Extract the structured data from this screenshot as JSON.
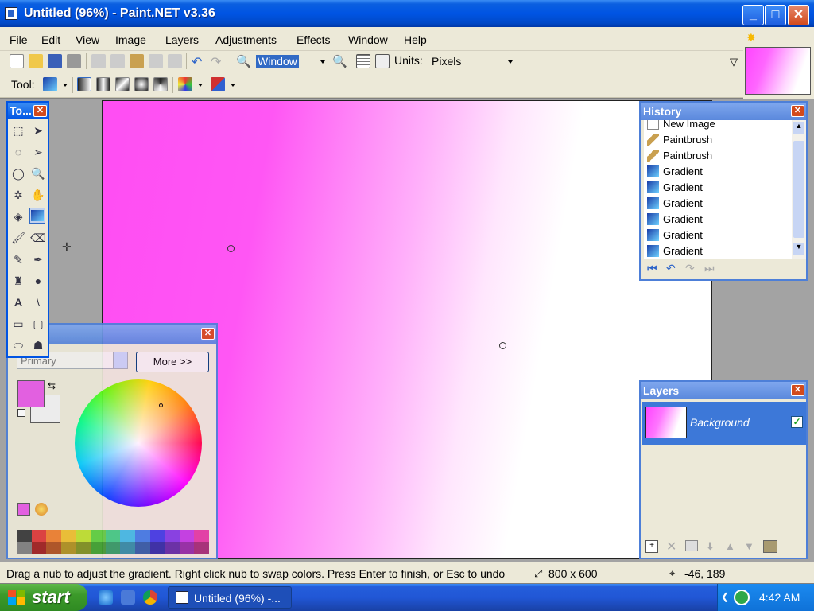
{
  "window": {
    "title": "Untitled (96%) - Paint.NET v3.36",
    "minimize": "_",
    "maximize": "□",
    "close": "✕"
  },
  "menu": [
    "File",
    "Edit",
    "View",
    "Image",
    "Layers",
    "Adjustments",
    "Effects",
    "Window",
    "Help"
  ],
  "toolbar": {
    "zoom_value": "Window",
    "units_label": "Units:",
    "units_value": "Pixels",
    "tool_label": "Tool:"
  },
  "tools_window": {
    "title": "To...",
    "close": "✕",
    "tools": [
      "rectangle-select",
      "move-selection",
      "lasso-select",
      "move-selected",
      "ellipse-select",
      "zoom",
      "magic-wand",
      "pan",
      "paint-bucket",
      "gradient",
      "paintbrush",
      "eraser",
      "pencil",
      "color-picker",
      "clone-stamp",
      "recolor",
      "text",
      "line-curve",
      "rectangle",
      "rounded-rectangle",
      "ellipse",
      "freeform-shape"
    ],
    "active_tool": "gradient"
  },
  "colors_window": {
    "close": "✕",
    "mode": "Primary",
    "more_button": "More >>",
    "primary_color": "#e85be6",
    "secondary_color": "#f3f3f3",
    "palette": [
      "#3a3a3a",
      "#e03a3a",
      "#f08030",
      "#f0c030",
      "#c0e030",
      "#60d040",
      "#40d080",
      "#40c0e0",
      "#4080e0",
      "#4040e0",
      "#8040e0",
      "#c040e0",
      "#e040a0",
      "#808080",
      "#a02020",
      "#b05020",
      "#b09020",
      "#809020",
      "#40a030",
      "#30a060",
      "#3090a0",
      "#3060a0",
      "#3030a0",
      "#6030a0",
      "#9030a0",
      "#a03070"
    ]
  },
  "history": {
    "title": "History",
    "close": "✕",
    "items": [
      "New Image",
      "Paintbrush",
      "Paintbrush",
      "Gradient",
      "Gradient",
      "Gradient",
      "Gradient",
      "Gradient",
      "Gradient"
    ]
  },
  "layers": {
    "title": "Layers",
    "close": "✕",
    "items": [
      {
        "name": "Background",
        "visible": true
      }
    ]
  },
  "status": {
    "message": "Drag a nub to adjust the gradient. Right click nub to swap colors. Press Enter to finish, or Esc to undo",
    "image_size": "800 x 600",
    "cursor_coords": "-46, 189"
  },
  "taskbar": {
    "start": "start",
    "task_item": "Untitled (96%) -...",
    "clock": "4:42 AM"
  }
}
